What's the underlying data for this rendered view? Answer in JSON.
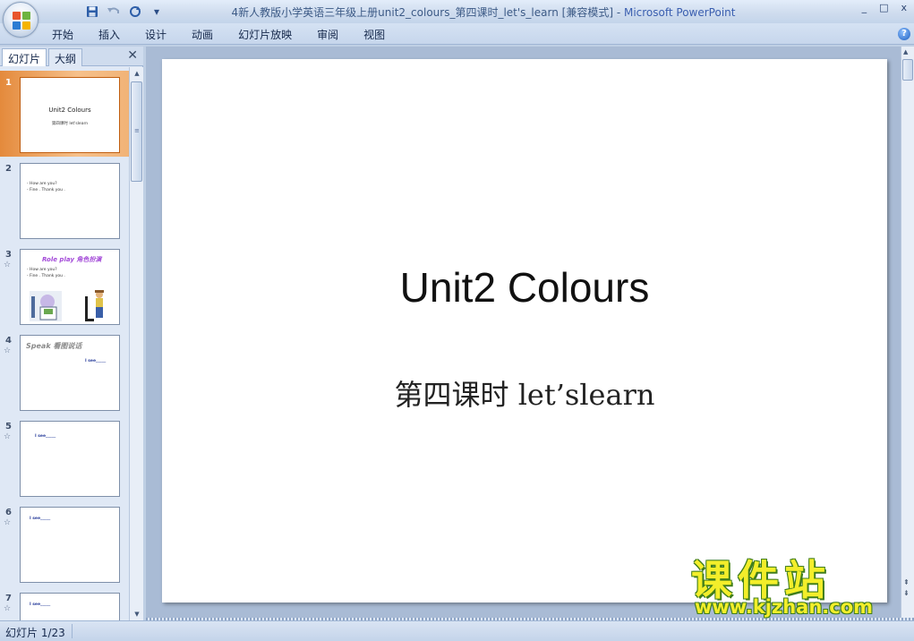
{
  "window": {
    "title": "4新人教版小学英语三年级上册unit2_colours_第四课时_let's_learn [兼容模式] - ",
    "app_name": "Microsoft PowerPoint",
    "controls": [
      "_",
      "□",
      "x"
    ]
  },
  "qat": {
    "save_icon": "save-icon",
    "undo_icon": "undo-icon",
    "redo_icon": "redo-icon",
    "more": "▾"
  },
  "ribbon": {
    "tabs": [
      "开始",
      "插入",
      "设计",
      "动画",
      "幻灯片放映",
      "审阅",
      "视图"
    ],
    "help": "?"
  },
  "left_panel": {
    "tab_slides": "幻灯片",
    "tab_outline": "大纲",
    "close": "✕",
    "thumbnails": [
      {
        "num": "1",
        "title": "Unit2 Colours",
        "subtitle": "第四课时 let'slearn"
      },
      {
        "num": "2",
        "lines": [
          "- How are you?",
          "- Fine . Thank you ."
        ]
      },
      {
        "num": "3",
        "wordart": "Role play 角色扮演",
        "lines": [
          "- How are you?",
          "- Fine . Thank you ."
        ]
      },
      {
        "num": "4",
        "wordart": "Speak 看图说话",
        "blank": "I see_____"
      },
      {
        "num": "5",
        "blank": "I see_____"
      },
      {
        "num": "6",
        "blank": "I see_____"
      },
      {
        "num": "7",
        "blank": "I see_____"
      }
    ]
  },
  "slide": {
    "title": "Unit2 Colours",
    "subtitle": "第四课时 let’slearn"
  },
  "statusbar": {
    "slide_info": "幻灯片 1/23"
  },
  "watermark": {
    "main": "课件站",
    "url": "www.kjzhan.com"
  },
  "colors": {
    "selected_thumb": "#e48a3c",
    "watermark_fill": "#f3ee2a",
    "watermark_outline": "#3f7d1c",
    "app_name": "#3b5fb0"
  }
}
